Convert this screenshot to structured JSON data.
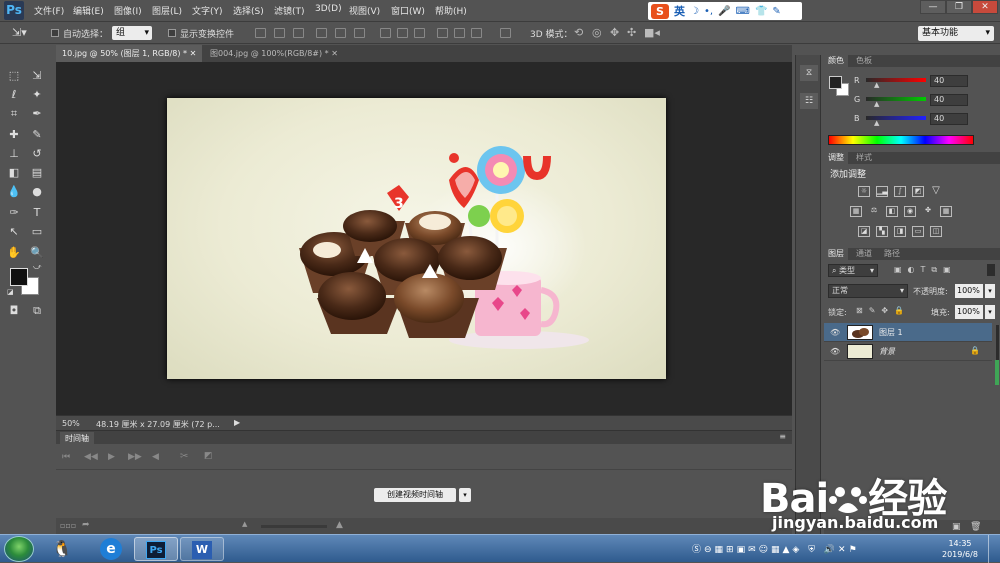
{
  "app": {
    "logo": "Ps"
  },
  "menu": {
    "items": [
      "文件(F)",
      "编辑(E)",
      "图像(I)",
      "图层(L)",
      "文字(Y)",
      "选择(S)",
      "滤镜(T)",
      "3D(D)",
      "视图(V)",
      "窗口(W)",
      "帮助(H)"
    ]
  },
  "ime": {
    "logo": "S",
    "mode": "英"
  },
  "window_controls": [
    "—",
    "❐",
    "✕"
  ],
  "options": {
    "auto_select_label": "自动选择：",
    "group_value": "组",
    "show_transform_label": "显示变换控件",
    "mode_3d_label": "3D 模式：",
    "workspace": "基本功能"
  },
  "tabs": [
    {
      "label": "10.jpg @ 50% (图层 1, RGB/8) *",
      "active": true
    },
    {
      "label": "图004.jpg @ 100%(RGB/8#) *",
      "active": false
    }
  ],
  "status": {
    "zoom": "50%",
    "doc_size": "48.19 厘米 x 27.09 厘米 (72 p..."
  },
  "timeline": {
    "title": "时间轴",
    "create_button": "创建视频时间轴"
  },
  "color_panel": {
    "tabs": [
      "颜色",
      "色板"
    ],
    "channels": [
      {
        "label": "R",
        "value": "40",
        "color": "#e53935"
      },
      {
        "label": "G",
        "value": "40",
        "color": "#43a047"
      },
      {
        "label": "B",
        "value": "40",
        "color": "#1e40c8"
      }
    ],
    "foreground": "#282828",
    "background": "#ffffff"
  },
  "adjust_panel": {
    "tabs": [
      "调整",
      "样式"
    ],
    "title": "添加调整"
  },
  "layers_panel": {
    "tabs": [
      "图层",
      "通道",
      "路径"
    ],
    "filter": "类型",
    "blend_mode": "正常",
    "opacity_label": "不透明度:",
    "opacity": "100%",
    "lock_label": "锁定:",
    "fill_label": "填充:",
    "fill": "100%",
    "layers": [
      {
        "name": "图层 1",
        "selected": true
      },
      {
        "name": "背景",
        "selected": false,
        "locked": true
      }
    ]
  },
  "taskbar": {
    "apps": [
      "Ps",
      "W"
    ],
    "time": "14:35",
    "date": "2019/6/8"
  },
  "watermark": {
    "brand_left": "Bai",
    "brand_right": "经验",
    "url": "jingyan.baidu.com"
  }
}
